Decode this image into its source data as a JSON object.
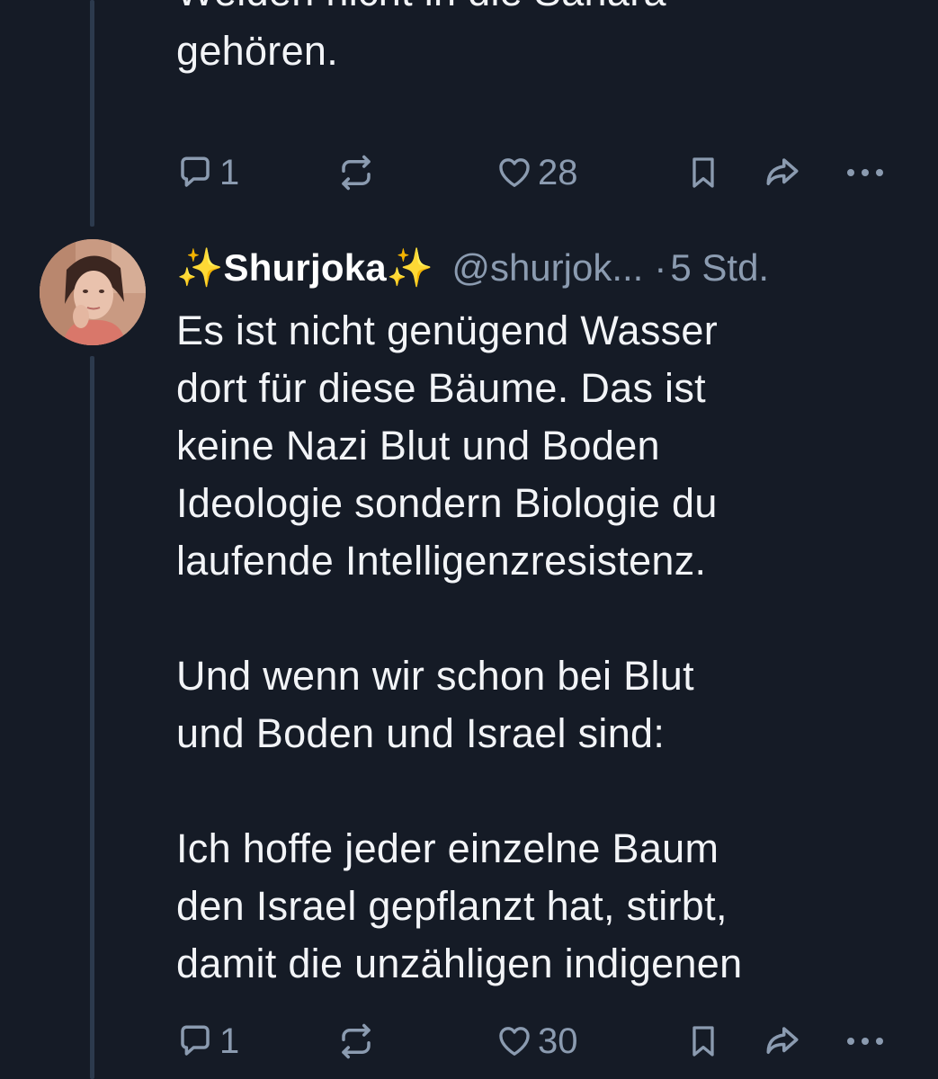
{
  "previous_post": {
    "text": "Weiden nicht in die Sahara\ngehören.",
    "actions": {
      "replies": "1",
      "likes": "28"
    }
  },
  "post": {
    "display_name": "✨Shurjoka✨",
    "handle": "@shurjok...",
    "separator": "·",
    "time": "5 Std.",
    "text": "Es ist nicht genügend Wasser\ndort für diese Bäume. Das ist\nkeine Nazi Blut und Boden\nIdeologie sondern Biologie du\nlaufende Intelligenzresistenz.\n\nUnd wenn wir schon bei Blut\nund Boden und Israel sind:\n\nIch hoffe jeder einzelne Baum\nden Israel gepflanzt hat, stirbt,\ndamit die unzähligen indigenen",
    "actions": {
      "replies": "1",
      "likes": "30"
    }
  },
  "icons": [
    "reply-icon",
    "repost-icon",
    "like-icon",
    "bookmark-icon",
    "share-icon",
    "more-icon"
  ],
  "colors": {
    "background": "#151b26",
    "text": "#f2f4f7",
    "muted": "#8b9bb0",
    "thread_line": "#2c3a4d"
  }
}
